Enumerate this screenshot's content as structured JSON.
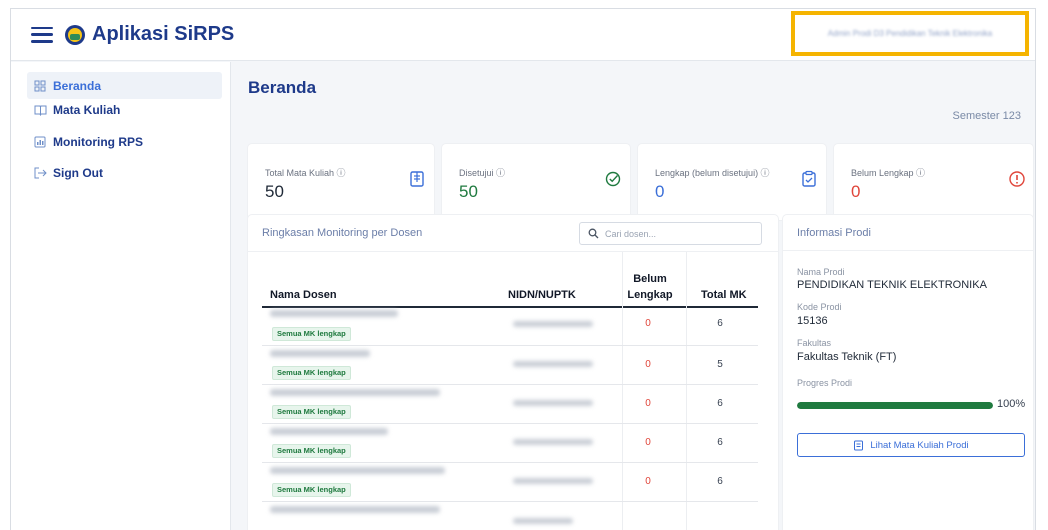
{
  "header": {
    "app_title": "Aplikasi SiRPS",
    "user_name": "Admin Prodi D3 Pendidikan Teknik Elektronika"
  },
  "sidebar": {
    "items": [
      {
        "label": "Beranda",
        "icon": "dashboard-icon",
        "active": true
      },
      {
        "label": "Mata Kuliah",
        "icon": "book-icon",
        "active": false
      },
      {
        "label": "Monitoring RPS",
        "icon": "monitor-icon",
        "active": false
      },
      {
        "label": "Sign Out",
        "icon": "sign-out-icon",
        "active": false
      }
    ]
  },
  "page": {
    "title": "Beranda",
    "semester": "Semester 123"
  },
  "stats": [
    {
      "label": "Total Mata Kuliah ⓘ",
      "value": "50",
      "color": "#1f2937",
      "icon": "clipboard-icon"
    },
    {
      "label": "Disetujui ⓘ",
      "value": "50",
      "color": "#1f7a3f",
      "icon": "check-circle-icon"
    },
    {
      "label": "Lengkap (belum disetujui) ⓘ",
      "value": "0",
      "color": "#3b6fd8",
      "icon": "clipboard-check-icon"
    },
    {
      "label": "Belum Lengkap ⓘ",
      "value": "0",
      "color": "#e0453a",
      "icon": "alert-circle-icon"
    }
  ],
  "summary": {
    "title": "Ringkasan Monitoring per Dosen",
    "search_placeholder": "Cari dosen...",
    "columns": {
      "nama": "Nama Dosen",
      "nidn": "NIDN/NUPTK",
      "belum_1": "Belum",
      "belum_2": "Lengkap",
      "total": "Total MK"
    },
    "rows": [
      {
        "badge": "Semua MK lengkap",
        "belum": "0",
        "total": "6"
      },
      {
        "badge": "Semua MK lengkap",
        "belum": "0",
        "total": "5"
      },
      {
        "badge": "Semua MK lengkap",
        "belum": "0",
        "total": "6"
      },
      {
        "badge": "Semua MK lengkap",
        "belum": "0",
        "total": "6"
      },
      {
        "badge": "Semua MK lengkap",
        "belum": "0",
        "total": "6"
      }
    ]
  },
  "info": {
    "title": "Informasi Prodi",
    "nama_label": "Nama Prodi",
    "nama_value": "PENDIDIKAN TEKNIK ELEKTRONIKA",
    "kode_label": "Kode Prodi",
    "kode_value": "15136",
    "fakultas_label": "Fakultas",
    "fakultas_value": "Fakultas Teknik (FT)",
    "progres_label": "Progres Prodi",
    "progres_value": "100%",
    "progres_fraction": 1.0,
    "button_label": "Lihat Mata Kuliah Prodi"
  }
}
